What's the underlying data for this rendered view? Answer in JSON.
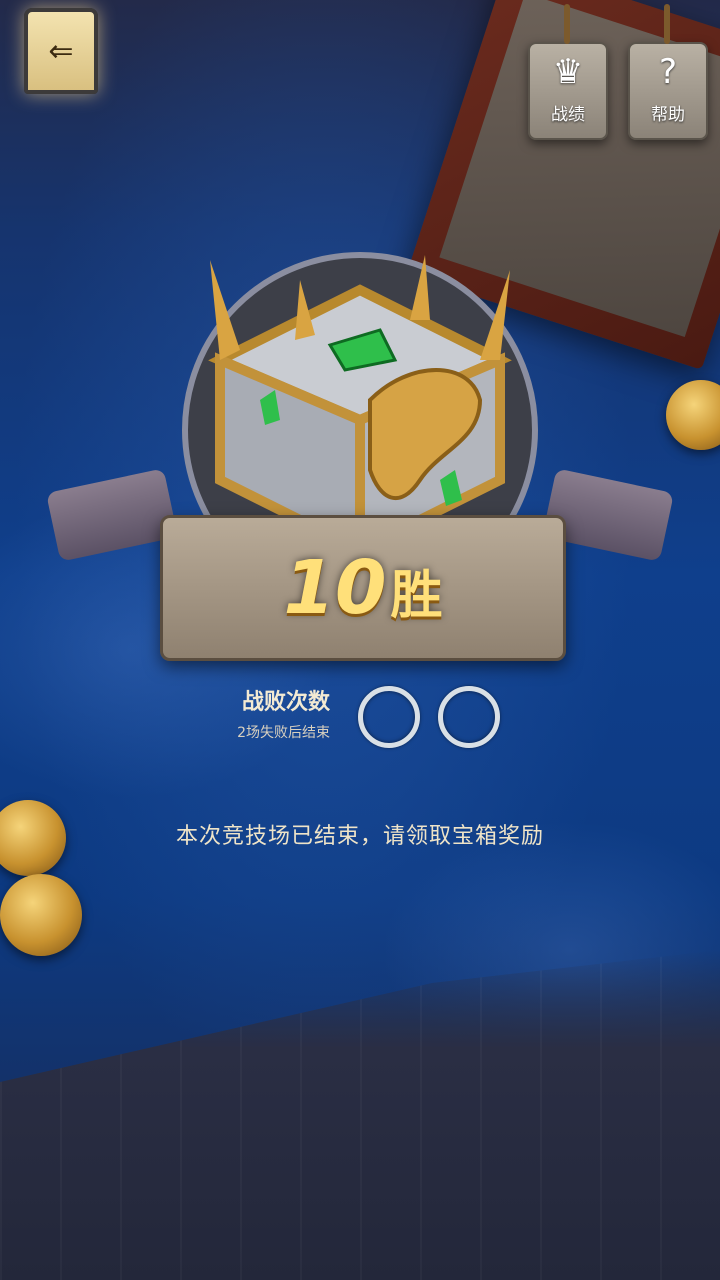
{
  "header": {
    "back_icon": "back-arrow-icon",
    "record_label": "战绩",
    "help_label": "帮助"
  },
  "reward": {
    "wins_number": "10",
    "wins_unit": "胜"
  },
  "losses": {
    "title": "战败次数",
    "subtitle": "2场失败后结束",
    "max_losses": 2,
    "current_losses": 0
  },
  "message": "本次竞技场已结束，请领取宝箱奖励",
  "colors": {
    "cloth": "#0f3f8c",
    "gold_text": "#ffe07a",
    "banner": "#b9ab98"
  }
}
